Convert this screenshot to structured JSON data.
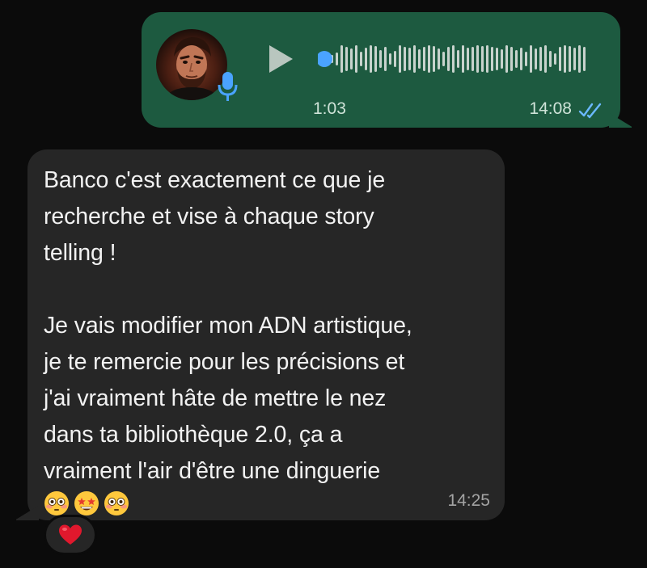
{
  "voice_message": {
    "duration": "1:03",
    "time": "14:08",
    "status": "read",
    "avatar_icon": "avatar-photo",
    "mic_icon": "microphone-icon",
    "play_icon": "play-icon",
    "playback_progress": 0.0,
    "colors": {
      "bubble": "#1d5a40",
      "waveform": "#c8d3cd",
      "progress_dot": "#4aa3ff",
      "read_receipt": "#6bb8ff"
    }
  },
  "text_message": {
    "paragraph_1": "Banco c'est exactement ce que je\nrecherche et vise à chaque story\ntelling !",
    "paragraph_2": "Je vais modifier mon ADN artistique,\nje te remercie pour les précisions et\nj'ai vraiment hâte de mettre le nez\ndans ta bibliothèque 2.0, ça a\nvraiment l'air d'être une dinguerie",
    "emojis": [
      "flushed-face",
      "star-struck-face",
      "flushed-face"
    ],
    "time": "14:25",
    "colors": {
      "bubble": "#262626"
    }
  },
  "reaction": {
    "emoji": "red-heart",
    "color": "#e0182d"
  }
}
